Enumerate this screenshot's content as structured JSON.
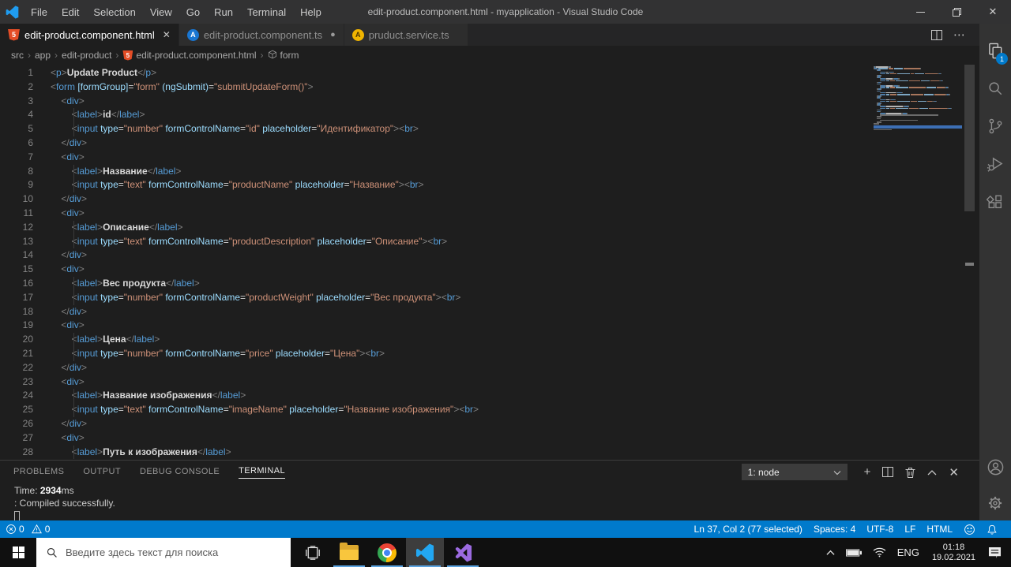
{
  "colors": {
    "statusbar_accent": "#007acc",
    "taskbar_run_indicator": "#5ba3e0",
    "minimap_selection": "#3d6fb4",
    "badge": "#007acc"
  },
  "titlebar": {
    "title": "edit-product.component.html - myapplication - Visual Studio Code",
    "menus": [
      "File",
      "Edit",
      "Selection",
      "View",
      "Go",
      "Run",
      "Terminal",
      "Help"
    ]
  },
  "tabs": [
    {
      "label": "edit-product.component.html",
      "icon": "html",
      "active": true,
      "modified": false,
      "icon_glyph": "5"
    },
    {
      "label": "edit-product.component.ts",
      "icon": "ng-blue",
      "active": false,
      "modified": true,
      "icon_glyph": "A"
    },
    {
      "label": "pruduct.service.ts",
      "icon": "ng-yellow",
      "active": false,
      "modified": false,
      "icon_glyph": "A"
    }
  ],
  "breadcrumb": {
    "items": [
      {
        "label": "src"
      },
      {
        "label": "app"
      },
      {
        "label": "edit-product"
      },
      {
        "label": "edit-product.component.html",
        "icon": "html",
        "icon_glyph": "5"
      },
      {
        "label": "form",
        "icon": "symbol"
      }
    ]
  },
  "editor": {
    "lines": [
      {
        "n": 1,
        "s": [
          [
            "p",
            "<"
          ],
          [
            "t",
            "p"
          ],
          [
            "p",
            ">"
          ],
          [
            "x",
            "Update Product"
          ],
          [
            "p",
            "</"
          ],
          [
            "t",
            "p"
          ],
          [
            "p",
            ">"
          ]
        ]
      },
      {
        "n": 2,
        "s": [
          [
            "p",
            "<"
          ],
          [
            "t",
            "form"
          ],
          [
            "e",
            " "
          ],
          [
            "a",
            "[formGroup]"
          ],
          [
            "e",
            "="
          ],
          [
            "v",
            "\"form\""
          ],
          [
            "e",
            " "
          ],
          [
            "a",
            "(ngSubmit)"
          ],
          [
            "e",
            "="
          ],
          [
            "v",
            "\"submitUpdateForm()\""
          ],
          [
            "p",
            ">"
          ]
        ]
      },
      {
        "n": 3,
        "s": [
          [
            "e",
            "    "
          ],
          [
            "p",
            "<"
          ],
          [
            "t",
            "div"
          ],
          [
            "p",
            ">"
          ]
        ]
      },
      {
        "n": 4,
        "s": [
          [
            "e",
            "        "
          ],
          [
            "p",
            "<"
          ],
          [
            "t",
            "label"
          ],
          [
            "p",
            ">"
          ],
          [
            "x",
            "id"
          ],
          [
            "p",
            "</"
          ],
          [
            "t",
            "label"
          ],
          [
            "p",
            ">"
          ]
        ]
      },
      {
        "n": 5,
        "s": [
          [
            "e",
            "        "
          ],
          [
            "p",
            "<"
          ],
          [
            "t",
            "input"
          ],
          [
            "e",
            " "
          ],
          [
            "a",
            "type"
          ],
          [
            "e",
            "="
          ],
          [
            "v",
            "\"number\""
          ],
          [
            "e",
            " "
          ],
          [
            "a",
            "formControlName"
          ],
          [
            "e",
            "="
          ],
          [
            "v",
            "\"id\""
          ],
          [
            "e",
            " "
          ],
          [
            "a",
            "placeholder"
          ],
          [
            "e",
            "="
          ],
          [
            "v",
            "\"Идентификатор\""
          ],
          [
            "p",
            "><"
          ],
          [
            "t",
            "br"
          ],
          [
            "p",
            ">"
          ]
        ]
      },
      {
        "n": 6,
        "s": [
          [
            "e",
            "    "
          ],
          [
            "p",
            "</"
          ],
          [
            "t",
            "div"
          ],
          [
            "p",
            ">"
          ]
        ]
      },
      {
        "n": 7,
        "s": [
          [
            "e",
            "    "
          ],
          [
            "p",
            "<"
          ],
          [
            "t",
            "div"
          ],
          [
            "p",
            ">"
          ]
        ]
      },
      {
        "n": 8,
        "s": [
          [
            "e",
            "        "
          ],
          [
            "p",
            "<"
          ],
          [
            "t",
            "label"
          ],
          [
            "p",
            ">"
          ],
          [
            "x",
            "Название"
          ],
          [
            "p",
            "</"
          ],
          [
            "t",
            "label"
          ],
          [
            "p",
            ">"
          ]
        ]
      },
      {
        "n": 9,
        "s": [
          [
            "e",
            "        "
          ],
          [
            "p",
            "<"
          ],
          [
            "t",
            "input"
          ],
          [
            "e",
            " "
          ],
          [
            "a",
            "type"
          ],
          [
            "e",
            "="
          ],
          [
            "v",
            "\"text\""
          ],
          [
            "e",
            " "
          ],
          [
            "a",
            "formControlName"
          ],
          [
            "e",
            "="
          ],
          [
            "v",
            "\"productName\""
          ],
          [
            "e",
            " "
          ],
          [
            "a",
            "placeholder"
          ],
          [
            "e",
            "="
          ],
          [
            "v",
            "\"Название\""
          ],
          [
            "p",
            "><"
          ],
          [
            "t",
            "br"
          ],
          [
            "p",
            ">"
          ]
        ]
      },
      {
        "n": 10,
        "s": [
          [
            "e",
            "    "
          ],
          [
            "p",
            "</"
          ],
          [
            "t",
            "div"
          ],
          [
            "p",
            ">"
          ]
        ]
      },
      {
        "n": 11,
        "s": [
          [
            "e",
            "    "
          ],
          [
            "p",
            "<"
          ],
          [
            "t",
            "div"
          ],
          [
            "p",
            ">"
          ]
        ]
      },
      {
        "n": 12,
        "s": [
          [
            "e",
            "        "
          ],
          [
            "p",
            "<"
          ],
          [
            "t",
            "label"
          ],
          [
            "p",
            ">"
          ],
          [
            "x",
            "Описание"
          ],
          [
            "p",
            "</"
          ],
          [
            "t",
            "label"
          ],
          [
            "p",
            ">"
          ]
        ]
      },
      {
        "n": 13,
        "s": [
          [
            "e",
            "        "
          ],
          [
            "p",
            "<"
          ],
          [
            "t",
            "input"
          ],
          [
            "e",
            " "
          ],
          [
            "a",
            "type"
          ],
          [
            "e",
            "="
          ],
          [
            "v",
            "\"text\""
          ],
          [
            "e",
            " "
          ],
          [
            "a",
            "formControlName"
          ],
          [
            "e",
            "="
          ],
          [
            "v",
            "\"productDescription\""
          ],
          [
            "e",
            " "
          ],
          [
            "a",
            "placeholder"
          ],
          [
            "e",
            "="
          ],
          [
            "v",
            "\"Описание\""
          ],
          [
            "p",
            "><"
          ],
          [
            "t",
            "br"
          ],
          [
            "p",
            ">"
          ]
        ]
      },
      {
        "n": 14,
        "s": [
          [
            "e",
            "    "
          ],
          [
            "p",
            "</"
          ],
          [
            "t",
            "div"
          ],
          [
            "p",
            ">"
          ]
        ]
      },
      {
        "n": 15,
        "s": [
          [
            "e",
            "    "
          ],
          [
            "p",
            "<"
          ],
          [
            "t",
            "div"
          ],
          [
            "p",
            ">"
          ]
        ]
      },
      {
        "n": 16,
        "s": [
          [
            "e",
            "        "
          ],
          [
            "p",
            "<"
          ],
          [
            "t",
            "label"
          ],
          [
            "p",
            ">"
          ],
          [
            "x",
            "Вес продукта"
          ],
          [
            "p",
            "</"
          ],
          [
            "t",
            "label"
          ],
          [
            "p",
            ">"
          ]
        ]
      },
      {
        "n": 17,
        "s": [
          [
            "e",
            "        "
          ],
          [
            "p",
            "<"
          ],
          [
            "t",
            "input"
          ],
          [
            "e",
            " "
          ],
          [
            "a",
            "type"
          ],
          [
            "e",
            "="
          ],
          [
            "v",
            "\"number\""
          ],
          [
            "e",
            " "
          ],
          [
            "a",
            "formControlName"
          ],
          [
            "e",
            "="
          ],
          [
            "v",
            "\"productWeight\""
          ],
          [
            "e",
            " "
          ],
          [
            "a",
            "placeholder"
          ],
          [
            "e",
            "="
          ],
          [
            "v",
            "\"Вес продукта\""
          ],
          [
            "p",
            "><"
          ],
          [
            "t",
            "br"
          ],
          [
            "p",
            ">"
          ]
        ]
      },
      {
        "n": 18,
        "s": [
          [
            "e",
            "    "
          ],
          [
            "p",
            "</"
          ],
          [
            "t",
            "div"
          ],
          [
            "p",
            ">"
          ]
        ]
      },
      {
        "n": 19,
        "s": [
          [
            "e",
            "    "
          ],
          [
            "p",
            "<"
          ],
          [
            "t",
            "div"
          ],
          [
            "p",
            ">"
          ]
        ]
      },
      {
        "n": 20,
        "s": [
          [
            "e",
            "        "
          ],
          [
            "p",
            "<"
          ],
          [
            "t",
            "label"
          ],
          [
            "p",
            ">"
          ],
          [
            "x",
            "Цена"
          ],
          [
            "p",
            "</"
          ],
          [
            "t",
            "label"
          ],
          [
            "p",
            ">"
          ]
        ]
      },
      {
        "n": 21,
        "s": [
          [
            "e",
            "        "
          ],
          [
            "p",
            "<"
          ],
          [
            "t",
            "input"
          ],
          [
            "e",
            " "
          ],
          [
            "a",
            "type"
          ],
          [
            "e",
            "="
          ],
          [
            "v",
            "\"number\""
          ],
          [
            "e",
            " "
          ],
          [
            "a",
            "formControlName"
          ],
          [
            "e",
            "="
          ],
          [
            "v",
            "\"price\""
          ],
          [
            "e",
            " "
          ],
          [
            "a",
            "placeholder"
          ],
          [
            "e",
            "="
          ],
          [
            "v",
            "\"Цена\""
          ],
          [
            "p",
            "><"
          ],
          [
            "t",
            "br"
          ],
          [
            "p",
            ">"
          ]
        ]
      },
      {
        "n": 22,
        "s": [
          [
            "e",
            "    "
          ],
          [
            "p",
            "</"
          ],
          [
            "t",
            "div"
          ],
          [
            "p",
            ">"
          ]
        ]
      },
      {
        "n": 23,
        "s": [
          [
            "e",
            "    "
          ],
          [
            "p",
            "<"
          ],
          [
            "t",
            "div"
          ],
          [
            "p",
            ">"
          ]
        ]
      },
      {
        "n": 24,
        "s": [
          [
            "e",
            "        "
          ],
          [
            "p",
            "<"
          ],
          [
            "t",
            "label"
          ],
          [
            "p",
            ">"
          ],
          [
            "x",
            "Название изображения"
          ],
          [
            "p",
            "</"
          ],
          [
            "t",
            "label"
          ],
          [
            "p",
            ">"
          ]
        ]
      },
      {
        "n": 25,
        "s": [
          [
            "e",
            "        "
          ],
          [
            "p",
            "<"
          ],
          [
            "t",
            "input"
          ],
          [
            "e",
            " "
          ],
          [
            "a",
            "type"
          ],
          [
            "e",
            "="
          ],
          [
            "v",
            "\"text\""
          ],
          [
            "e",
            " "
          ],
          [
            "a",
            "formControlName"
          ],
          [
            "e",
            "="
          ],
          [
            "v",
            "\"imageName\""
          ],
          [
            "e",
            " "
          ],
          [
            "a",
            "placeholder"
          ],
          [
            "e",
            "="
          ],
          [
            "v",
            "\"Название изображения\""
          ],
          [
            "p",
            "><"
          ],
          [
            "t",
            "br"
          ],
          [
            "p",
            ">"
          ]
        ]
      },
      {
        "n": 26,
        "s": [
          [
            "e",
            "    "
          ],
          [
            "p",
            "</"
          ],
          [
            "t",
            "div"
          ],
          [
            "p",
            ">"
          ]
        ]
      },
      {
        "n": 27,
        "s": [
          [
            "e",
            "    "
          ],
          [
            "p",
            "<"
          ],
          [
            "t",
            "div"
          ],
          [
            "p",
            ">"
          ]
        ]
      },
      {
        "n": 28,
        "s": [
          [
            "e",
            "        "
          ],
          [
            "p",
            "<"
          ],
          [
            "t",
            "label"
          ],
          [
            "p",
            ">"
          ],
          [
            "x",
            "Путь к изображения"
          ],
          [
            "p",
            "</"
          ],
          [
            "t",
            "label"
          ],
          [
            "p",
            ">"
          ]
        ]
      }
    ],
    "minimap_tail": [
      [
        8,
        70
      ],
      [
        4,
        6
      ],
      [
        4,
        5
      ],
      [
        8,
        45
      ],
      [
        4,
        6
      ],
      [
        0,
        7
      ]
    ],
    "minimap_trailing": [
      [
        0,
        22
      ]
    ]
  },
  "activity_bar": {
    "explorer_badge": "1"
  },
  "panel": {
    "tabs": [
      {
        "label": "PROBLEMS",
        "active": false
      },
      {
        "label": "OUTPUT",
        "active": false
      },
      {
        "label": "DEBUG CONSOLE",
        "active": false
      },
      {
        "label": "TERMINAL",
        "active": true
      }
    ],
    "dropdown_value": "1: node",
    "terminal_lines": [
      [
        {
          "t": "Time: ",
          "b": false
        },
        {
          "t": "2934",
          "b": true
        },
        {
          "t": "ms",
          "b": false
        }
      ],
      [
        {
          "t": ": Compiled successfully.",
          "b": false
        }
      ]
    ]
  },
  "statusbar": {
    "errors": "0",
    "warnings": "0",
    "right_items": [
      {
        "name": "cursor-position",
        "label": "Ln 37, Col 2 (77 selected)"
      },
      {
        "name": "indentation",
        "label": "Spaces: 4"
      },
      {
        "name": "encoding",
        "label": "UTF-8"
      },
      {
        "name": "eol",
        "label": "LF"
      },
      {
        "name": "language-mode",
        "label": "HTML"
      }
    ]
  },
  "taskbar": {
    "search_placeholder": "Введите здесь текст для поиска",
    "tray": {
      "language": "ENG",
      "time": "01:18",
      "date": "19.02.2021"
    }
  }
}
